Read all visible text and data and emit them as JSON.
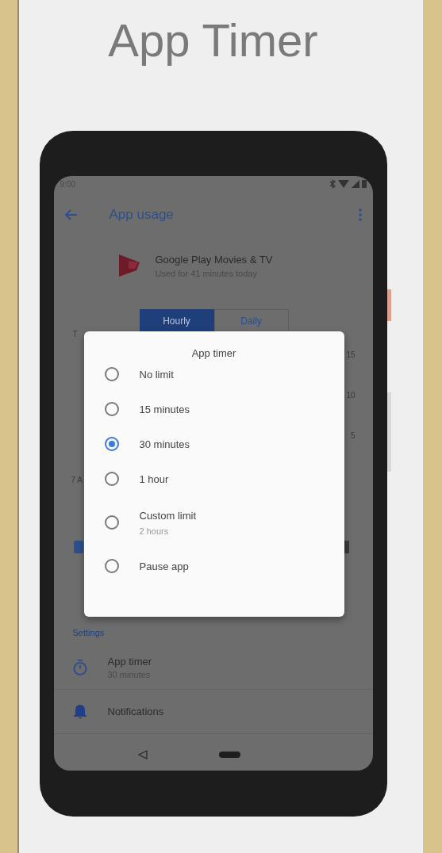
{
  "page_title": "App Timer",
  "status_bar": {
    "time": "9:00"
  },
  "app_bar": {
    "title": "App usage"
  },
  "app": {
    "name": "Google Play Movies & TV",
    "usage": "Used for 41 minutes today"
  },
  "view_tabs": [
    {
      "label": "Hourly",
      "selected": true
    },
    {
      "label": "Daily",
      "selected": false
    }
  ],
  "chart_fragments": {
    "title": "T",
    "y_labels": [
      "15",
      "10",
      "5"
    ],
    "x_label": "7 A"
  },
  "dialog": {
    "title": "App timer",
    "options": [
      {
        "label": "No limit",
        "selected": false
      },
      {
        "label": "15 minutes",
        "selected": false
      },
      {
        "label": "30 minutes",
        "selected": true
      },
      {
        "label": "1 hour",
        "selected": false
      },
      {
        "label": "Custom limit",
        "detail": "2 hours",
        "selected": false
      },
      {
        "label": "Pause app",
        "selected": false
      }
    ]
  },
  "settings": {
    "heading": "Settings",
    "items": [
      {
        "kind": "timer",
        "title": "App timer",
        "subtitle": "30 minutes"
      },
      {
        "kind": "notifications",
        "title": "Notifications"
      }
    ]
  }
}
